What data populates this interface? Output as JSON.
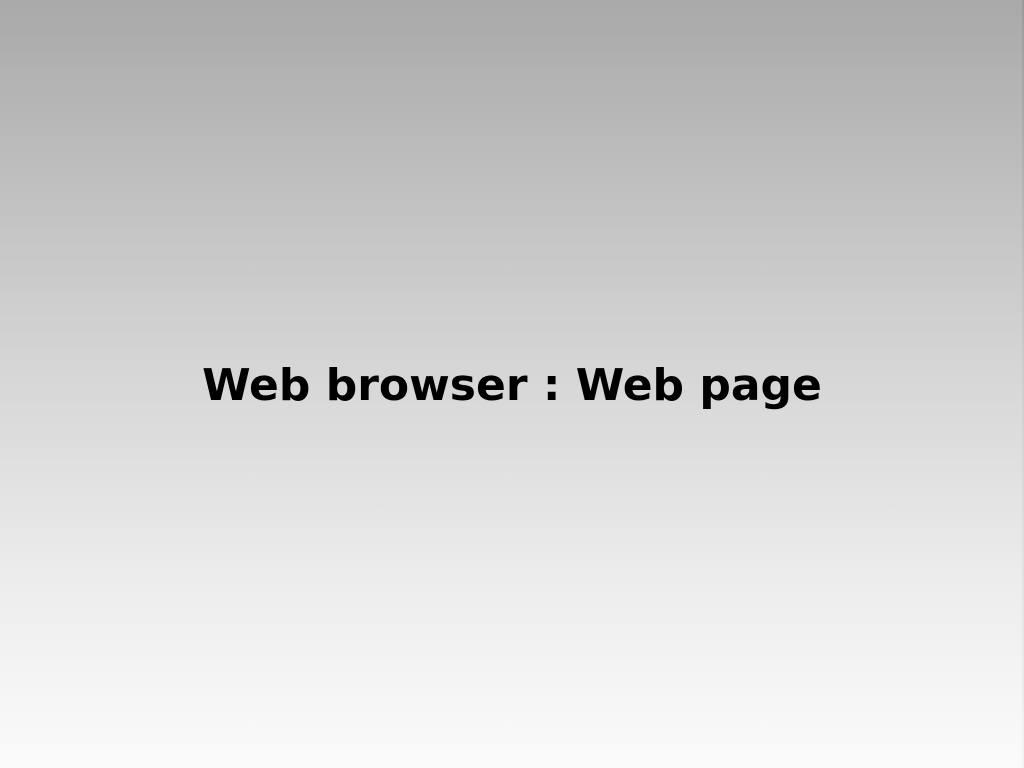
{
  "slide": {
    "title": "Web browser : Web page"
  },
  "colors": {
    "background_top": "#a9a9a9",
    "background_bottom": "#fbfbfb",
    "text": "#000000"
  }
}
